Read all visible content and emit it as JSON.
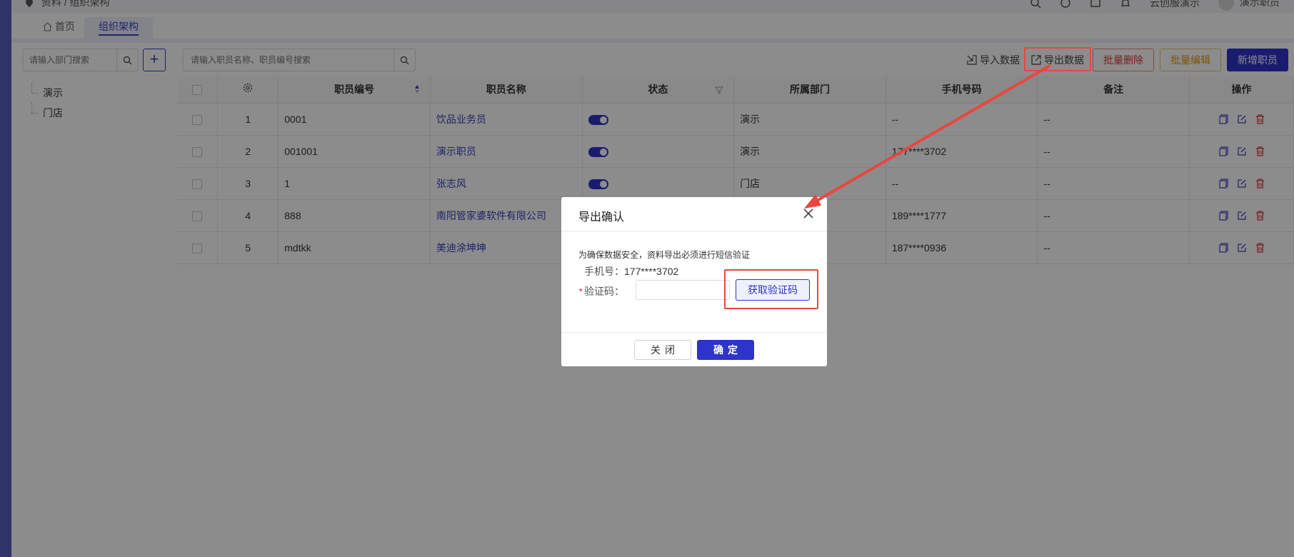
{
  "topbar": {
    "breadcrumb": "资料 / 组织架构",
    "store_label": "云创服演示",
    "user_name": "演示职员"
  },
  "tabs": [
    {
      "label": "首页"
    },
    {
      "label": "组织架构"
    }
  ],
  "sidebar": {
    "search_placeholder": "请输入部门搜索",
    "add_label": "+",
    "departments": [
      {
        "label": "演示"
      },
      {
        "label": "门店"
      }
    ]
  },
  "toolbar": {
    "search_placeholder": "请输入职员名称、职员编号搜索",
    "import_label": "导入数据",
    "export_label": "导出数据",
    "batch_delete_label": "批量删除",
    "batch_edit_label": "批量编辑",
    "add_employee_label": "新增职员"
  },
  "table": {
    "headers": [
      "职员编号",
      "职员名称",
      "状态",
      "所属部门",
      "手机号码",
      "备注",
      "操作"
    ],
    "rows": [
      {
        "index": "1",
        "code": "0001",
        "name": "饮品业务员",
        "enabled": true,
        "dept": "演示",
        "phone": "--",
        "note": "--"
      },
      {
        "index": "2",
        "code": "001001",
        "name": "演示职员",
        "enabled": true,
        "dept": "演示",
        "phone": "177****3702",
        "note": "--"
      },
      {
        "index": "3",
        "code": "1",
        "name": "张志风",
        "enabled": true,
        "dept": "门店",
        "phone": "--",
        "note": "--"
      },
      {
        "index": "4",
        "code": "888",
        "name": "南阳管家婆软件有限公司",
        "enabled": true,
        "dept": "",
        "phone": "189****1777",
        "note": "--"
      },
      {
        "index": "5",
        "code": "mdtkk",
        "name": "美迪涂坤坤",
        "enabled": true,
        "dept": "",
        "phone": "187****0936",
        "note": "--"
      }
    ]
  },
  "dialog": {
    "title": "导出确认",
    "notice": "为确保数据安全，资料导出必须进行短信验证",
    "phone_label": "手机号：",
    "phone_value": "177****3702",
    "code_label": "验证码：",
    "required_mark": "*",
    "get_code_label": "获取验证码",
    "close_label": "关闭",
    "ok_label": "确定"
  },
  "colors": {
    "primary": "#2e34c9",
    "danger": "#d9363e",
    "warning": "#e39a17",
    "annotation": "#e8473e"
  }
}
